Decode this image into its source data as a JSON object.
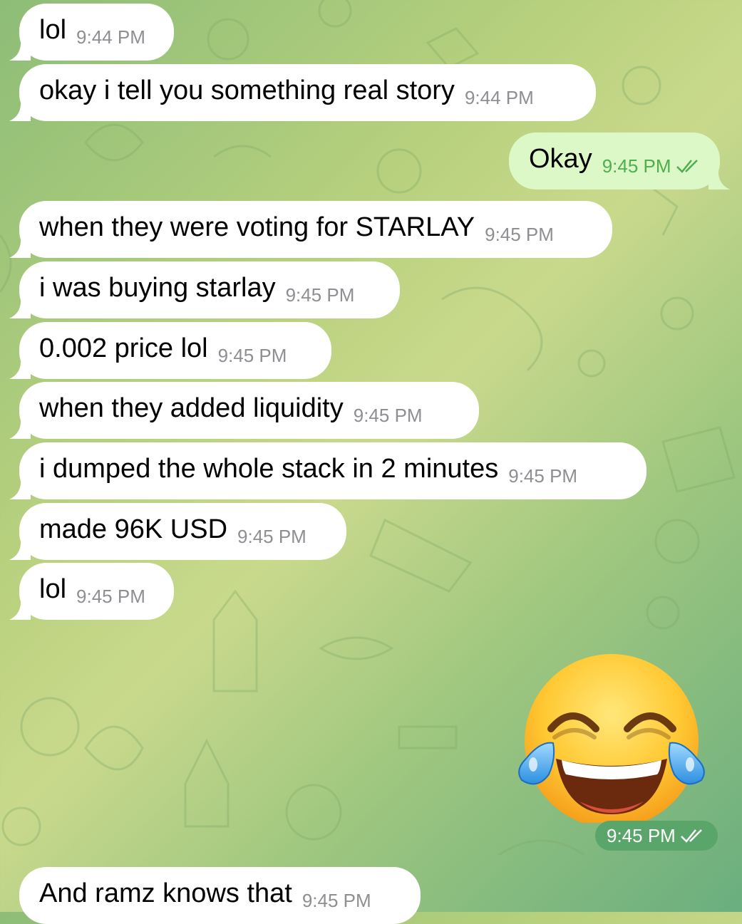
{
  "messages": [
    {
      "text": "lol",
      "time": "9:44 PM"
    },
    {
      "text": "okay i tell you something real story",
      "time": "9:44 PM"
    },
    {
      "text": "Okay",
      "time": "9:45 PM"
    },
    {
      "text": "when they were voting for STARLAY",
      "time": "9:45 PM"
    },
    {
      "text": "i was buying starlay",
      "time": "9:45 PM"
    },
    {
      "text": "0.002 price lol",
      "time": "9:45 PM"
    },
    {
      "text": "when they added liquidity",
      "time": "9:45 PM"
    },
    {
      "text": "i dumped the whole stack in 2 minutes",
      "time": "9:45 PM"
    },
    {
      "text": "made 96K USD",
      "time": "9:45 PM"
    },
    {
      "text": "lol",
      "time": "9:45 PM"
    },
    {
      "text": "And ramz knows that",
      "time": "9:45 PM"
    }
  ],
  "emoji_message": {
    "emoji": "face-with-tears-of-joy",
    "time": "9:45 PM"
  },
  "colors": {
    "incoming_bubble": "#ffffff",
    "outgoing_bubble": "#dcf8c6",
    "outgoing_time": "#4fae4e",
    "incoming_time": "#8e8e93",
    "check_marks": "#4fae4e"
  }
}
